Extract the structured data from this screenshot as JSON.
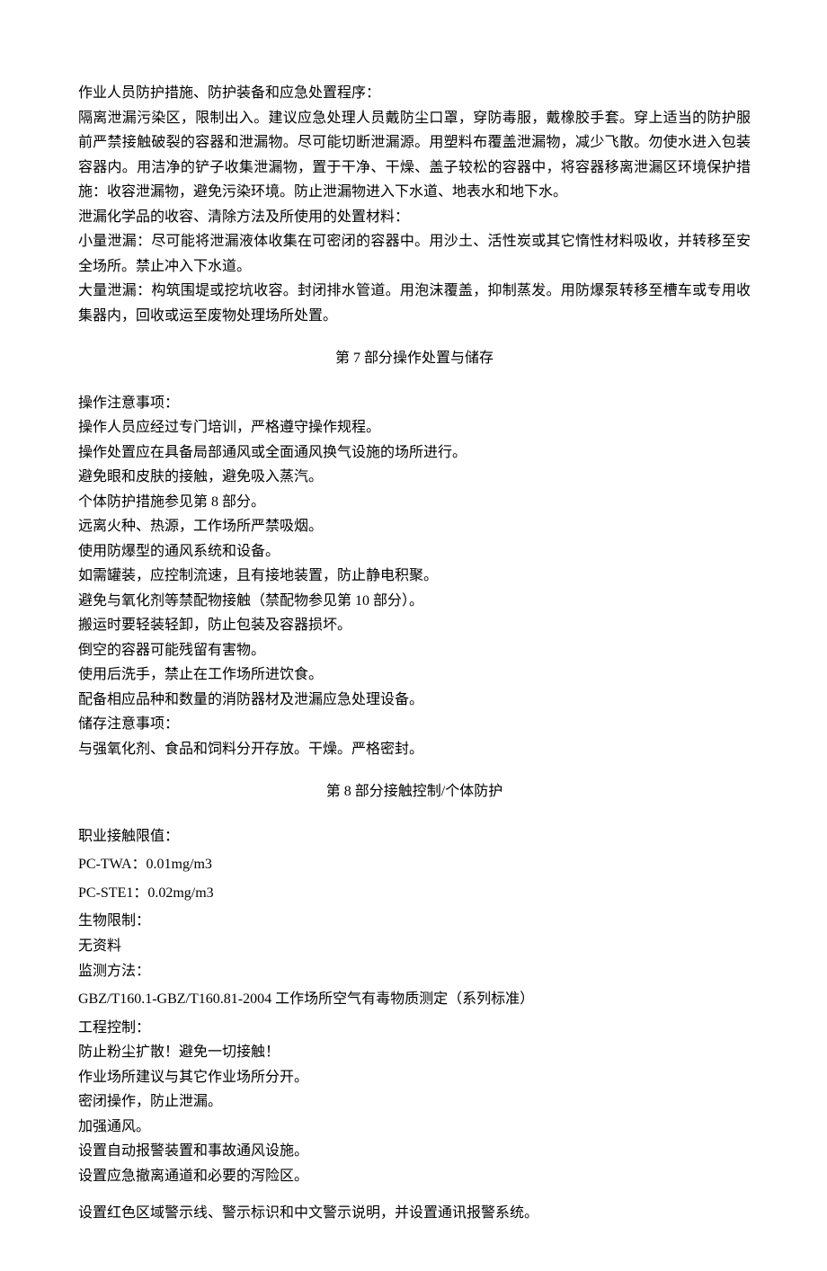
{
  "section6": {
    "items": [
      "作业人员防护措施、防护装备和应急处置程序：",
      "隔离泄漏污染区，限制出入。建议应急处理人员戴防尘口罩，穿防毒服，戴橡胶手套。穿上适当的防护服前严禁接触破裂的容器和泄漏物。尽可能切断泄漏源。用塑料布覆盖泄漏物，减少飞散。勿使水进入包装容器内。用洁净的铲子收集泄漏物，置于干净、干燥、盖子较松的容器中，将容器移离泄漏区环境保护措施：收容泄漏物，避免污染环境。防止泄漏物进入下水道、地表水和地下水。",
      "泄漏化学品的收容、清除方法及所使用的处置材料：",
      "小量泄漏：尽可能将泄漏液体收集在可密闭的容器中。用沙土、活性炭或其它惰性材料吸收，并转移至安全场所。禁止冲入下水道。",
      "大量泄漏：构筑围堤或挖坑收容。封闭排水管道。用泡沫覆盖，抑制蒸发。用防爆泵转移至槽车或专用收集器内，回收或运至废物处理场所处置。"
    ]
  },
  "section7": {
    "heading_prefix": "第",
    "heading_num": " 7 ",
    "heading_suffix": "部分操作处置与储存",
    "items": [
      "操作注意事项：",
      "操作人员应经过专门培训，严格遵守操作规程。",
      "操作处置应在具备局部通风或全面通风换气设施的场所进行。",
      "避免眼和皮肤的接触，避免吸入蒸汽。",
      "个体防护措施参见第 8 部分。",
      "远离火种、热源，工作场所严禁吸烟。",
      "使用防爆型的通风系统和设备。",
      "如需罐装，应控制流速，且有接地装置，防止静电积聚。",
      "避免与氧化剂等禁配物接触（禁配物参见第 10 部分）。",
      "搬运时要轻装轻卸，防止包装及容器损坏。",
      "倒空的容器可能残留有害物。",
      "使用后洗手，禁止在工作场所进饮食。",
      "配备相应品种和数量的消防器材及泄漏应急处理设备。",
      "储存注意事项：",
      "与强氧化剂、食品和饲料分开存放。干燥。严格密封。"
    ]
  },
  "section8": {
    "heading_prefix": "第",
    "heading_num": " 8 ",
    "heading_suffix": "部分接触控制/个体防护",
    "occ_label": "职业接触限值：",
    "pc_twa": "PC-TWA：0.01mg/m3",
    "pc_ste1": "PC-STE1：0.02mg/m3",
    "bio_label": "生物限制：",
    "bio_value": "无资料",
    "monitor_label": "监测方法：",
    "monitor_value": "GBZ/T160.1-GBZ/T160.81-2004 工作场所空气有毒物质测定（系列标准）",
    "eng_label": "工程控制：",
    "eng_items": [
      "防止粉尘扩散！避免一切接触！",
      "作业场所建议与其它作业场所分开。",
      "密闭操作，防止泄漏。",
      "加强通风。",
      "设置自动报警装置和事故通风设施。",
      "设置应急撤离通道和必要的泻险区。"
    ],
    "eng_last": "设置红色区域警示线、警示标识和中文警示说明，并设置通讯报警系统。"
  }
}
